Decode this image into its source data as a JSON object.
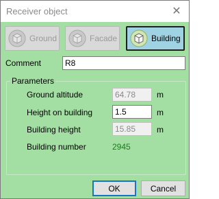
{
  "window": {
    "title": "Receiver object"
  },
  "types": [
    {
      "label": "Ground",
      "active": false
    },
    {
      "label": "Facade",
      "active": false
    },
    {
      "label": "Building",
      "active": true
    }
  ],
  "comment": {
    "label": "Comment",
    "value": "R8"
  },
  "parameters": {
    "title": "Parameters",
    "ground_altitude": {
      "label": "Ground altitude",
      "value": "64.78",
      "unit": "m"
    },
    "height_on_building": {
      "label": "Height on building",
      "value": "1.5",
      "unit": "m"
    },
    "building_height": {
      "label": "Building height",
      "value": "15.85",
      "unit": "m"
    },
    "building_number": {
      "label": "Building number",
      "value": "2945"
    }
  },
  "buttons": {
    "ok": "OK",
    "cancel": "Cancel"
  },
  "icons": {
    "close": "close-icon",
    "cube": "cube-icon"
  },
  "colors": {
    "background": "#a3dea3",
    "active_button": "#9fd3e3",
    "accent": "#1b73c8",
    "building_number": "#1c7d1c"
  }
}
